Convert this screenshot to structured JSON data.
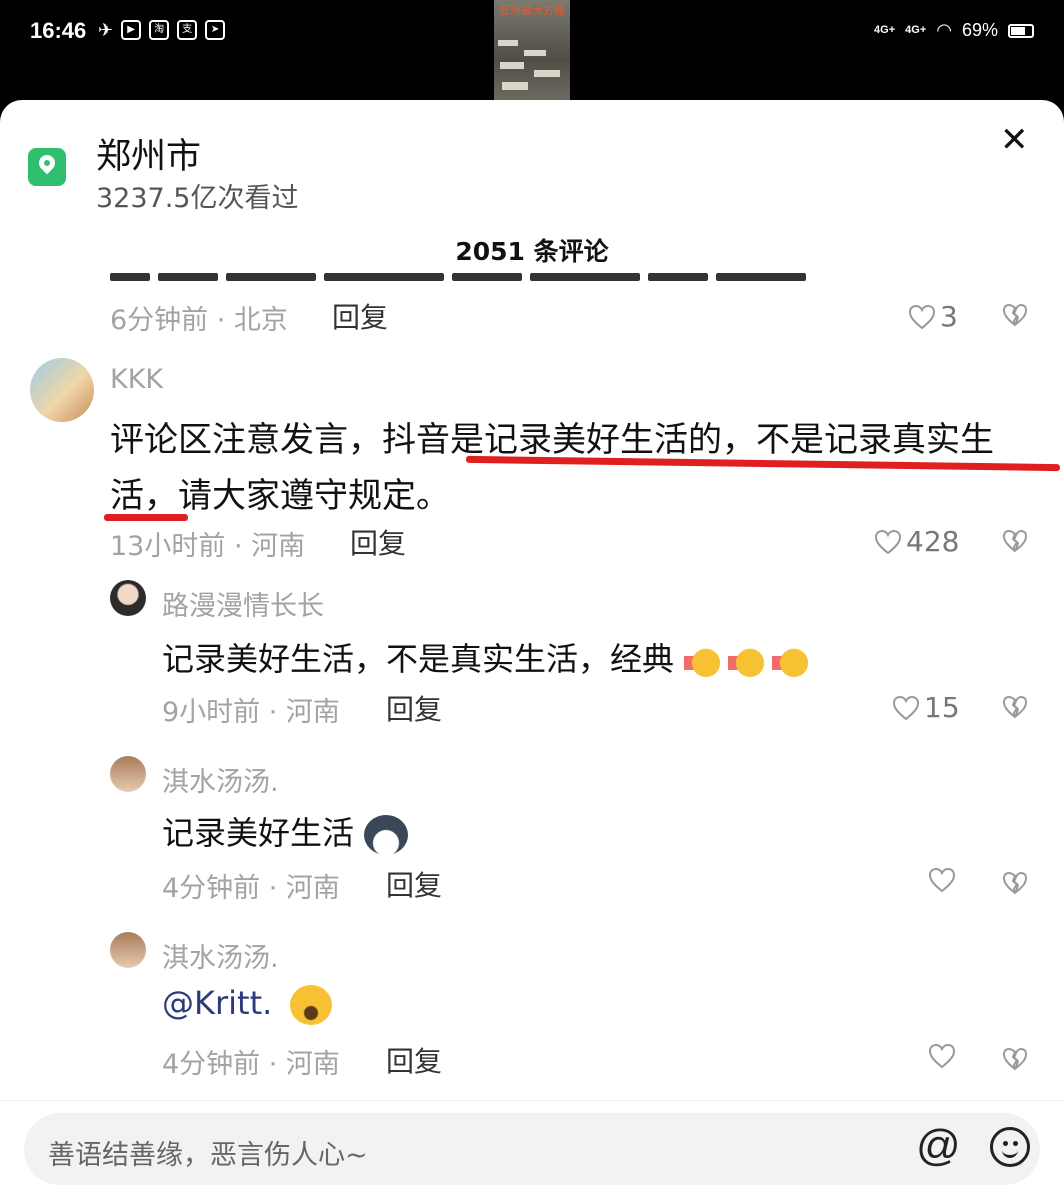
{
  "status_bar": {
    "time": "16:46",
    "app_icons": [
      "淘",
      "支"
    ],
    "video_thumbnail_title": "亚洲最大方舱",
    "signal_1": "4G+",
    "signal_2": "4G+",
    "battery": "69%",
    "battery_level": 0.69
  },
  "header": {
    "location_title": "郑州市",
    "views": "3237.5亿次看过",
    "comment_count": "2051 条评论"
  },
  "comments": [
    {
      "meta": "6分钟前 · 北京",
      "reply": "回复",
      "likes": "3"
    },
    {
      "name": "KKK",
      "text_line1": "评论区注意发言，抖音是记录美好生活的，不是记录真实生",
      "text_line2": "活，请大家遵守规定。",
      "meta": "13小时前 · 河南",
      "reply": "回复",
      "likes": "428"
    },
    {
      "name": "路漫漫情长长",
      "text": "记录美好生活，不是真实生活，经典",
      "emoji": "thumbs-up x3",
      "meta": "9小时前 · 河南",
      "reply": "回复",
      "likes": "15"
    },
    {
      "name": "淇水汤汤.",
      "text": "记录美好生活",
      "emoji": "dog-face",
      "meta": "4分钟前 · 河南",
      "reply": "回复",
      "likes": ""
    },
    {
      "name": "淇水汤汤.",
      "text": "@Kritt.",
      "emoji": "laughing-crying-face",
      "meta": "4分钟前 · 河南",
      "reply": "回复",
      "likes": ""
    }
  ],
  "input": {
    "placeholder": "善语结善缘，恶言伤人心~"
  },
  "colors": {
    "location_green": "#2fbf6f",
    "underline_red": "#e02020",
    "mention_blue": "#2b3a7a"
  }
}
